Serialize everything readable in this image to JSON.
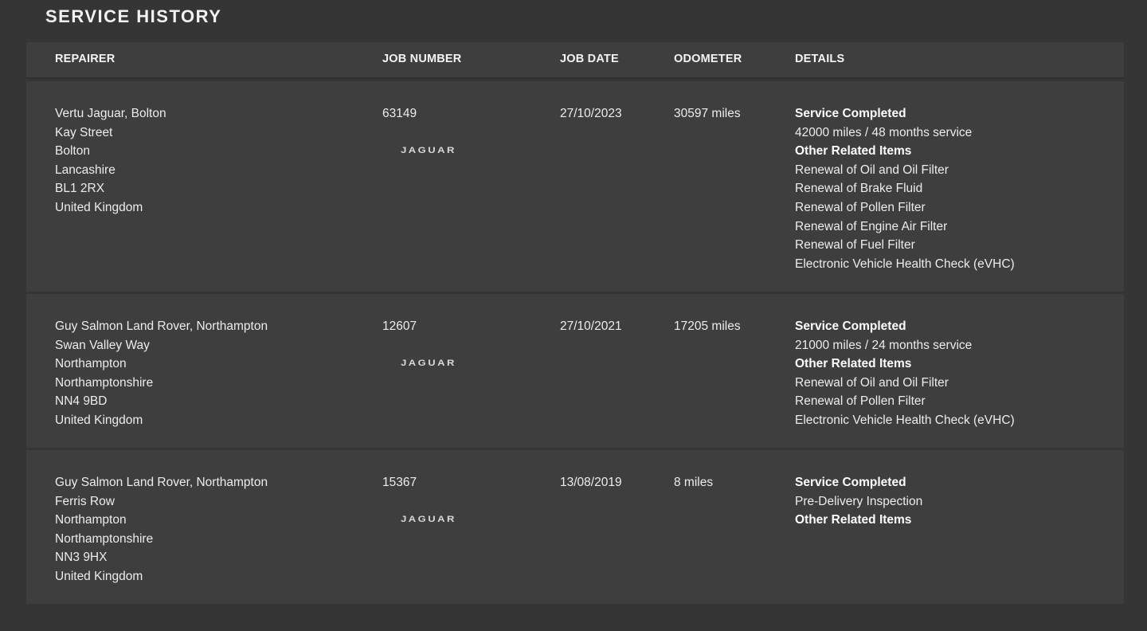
{
  "page": {
    "title": "SERVICE HISTORY"
  },
  "table": {
    "headers": {
      "repairer": "REPAIRER",
      "job_number": "JOB NUMBER",
      "job_date": "JOB DATE",
      "odometer": "ODOMETER",
      "details": "DETAILS"
    },
    "rows": [
      {
        "repairer": [
          "Vertu Jaguar, Bolton",
          "Kay Street",
          "Bolton",
          "Lancashire",
          "BL1 2RX",
          "United Kingdom"
        ],
        "job_number": "63149",
        "brand": "JAGUAR",
        "job_date": "27/10/2023",
        "odometer": "30597 miles",
        "details": {
          "service_heading": "Service Completed",
          "service": "42000 miles / 48 months service",
          "related_heading": "Other Related Items",
          "items": [
            "Renewal of Oil and Oil Filter",
            "Renewal of Brake Fluid",
            "Renewal of Pollen Filter",
            "Renewal of Engine Air Filter",
            "Renewal of Fuel Filter",
            "Electronic Vehicle Health Check (eVHC)"
          ]
        }
      },
      {
        "repairer": [
          "Guy Salmon Land Rover, Northampton",
          "Swan Valley Way",
          "Northampton",
          "Northamptonshire",
          "NN4 9BD",
          "United Kingdom"
        ],
        "job_number": "12607",
        "brand": "JAGUAR",
        "job_date": "27/10/2021",
        "odometer": "17205 miles",
        "details": {
          "service_heading": "Service Completed",
          "service": "21000 miles / 24 months service",
          "related_heading": "Other Related Items",
          "items": [
            "Renewal of Oil and Oil Filter",
            "Renewal of Pollen Filter",
            "Electronic Vehicle Health Check (eVHC)"
          ]
        }
      },
      {
        "repairer": [
          "Guy Salmon Land Rover, Northampton",
          "Ferris Row",
          "Northampton",
          "Northamptonshire",
          "NN3 9HX",
          "United Kingdom"
        ],
        "job_number": "15367",
        "brand": "JAGUAR",
        "job_date": "13/08/2019",
        "odometer": "8 miles",
        "details": {
          "service_heading": "Service Completed",
          "service": "Pre-Delivery Inspection",
          "related_heading": "Other Related Items",
          "items": []
        }
      }
    ]
  }
}
